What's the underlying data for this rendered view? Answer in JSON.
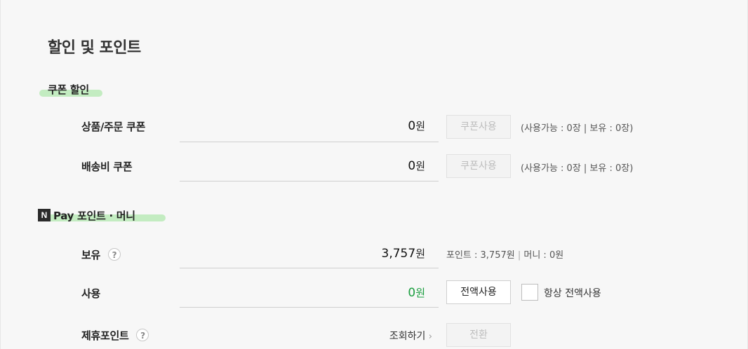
{
  "page": {
    "title": "할인 및 포인트"
  },
  "coupon_section": {
    "title": "쿠폰 할인",
    "rows": [
      {
        "label": "상품/주문 쿠폰",
        "amount": "0",
        "unit": "원",
        "button": "쿠폰사용",
        "availability": "(사용가능 : 0장 | 보유 : 0장)"
      },
      {
        "label": "배송비 쿠폰",
        "amount": "0",
        "unit": "원",
        "button": "쿠폰사용",
        "availability": "(사용가능 : 0장 | 보유 : 0장)"
      }
    ]
  },
  "npay_section": {
    "logo_letter": "N",
    "title": "Pay 포인트 · 머니",
    "balance": {
      "label": "보유",
      "help": "?",
      "amount": "3,757",
      "unit": "원",
      "detail_points": "포인트 : 3,757원",
      "detail_sep": "|",
      "detail_money": "머니 : 0원"
    },
    "use": {
      "label": "사용",
      "amount": "0",
      "unit": "원",
      "button": "전액사용",
      "always_label": "항상 전액사용",
      "always_checked": false
    },
    "partner": {
      "label": "제휴포인트",
      "help": "?",
      "lookup": "조회하기",
      "lookup_arrow": "›",
      "button": "전환"
    }
  },
  "colors": {
    "highlight": "#b2e8af",
    "green_amount": "#1a9e3f"
  }
}
